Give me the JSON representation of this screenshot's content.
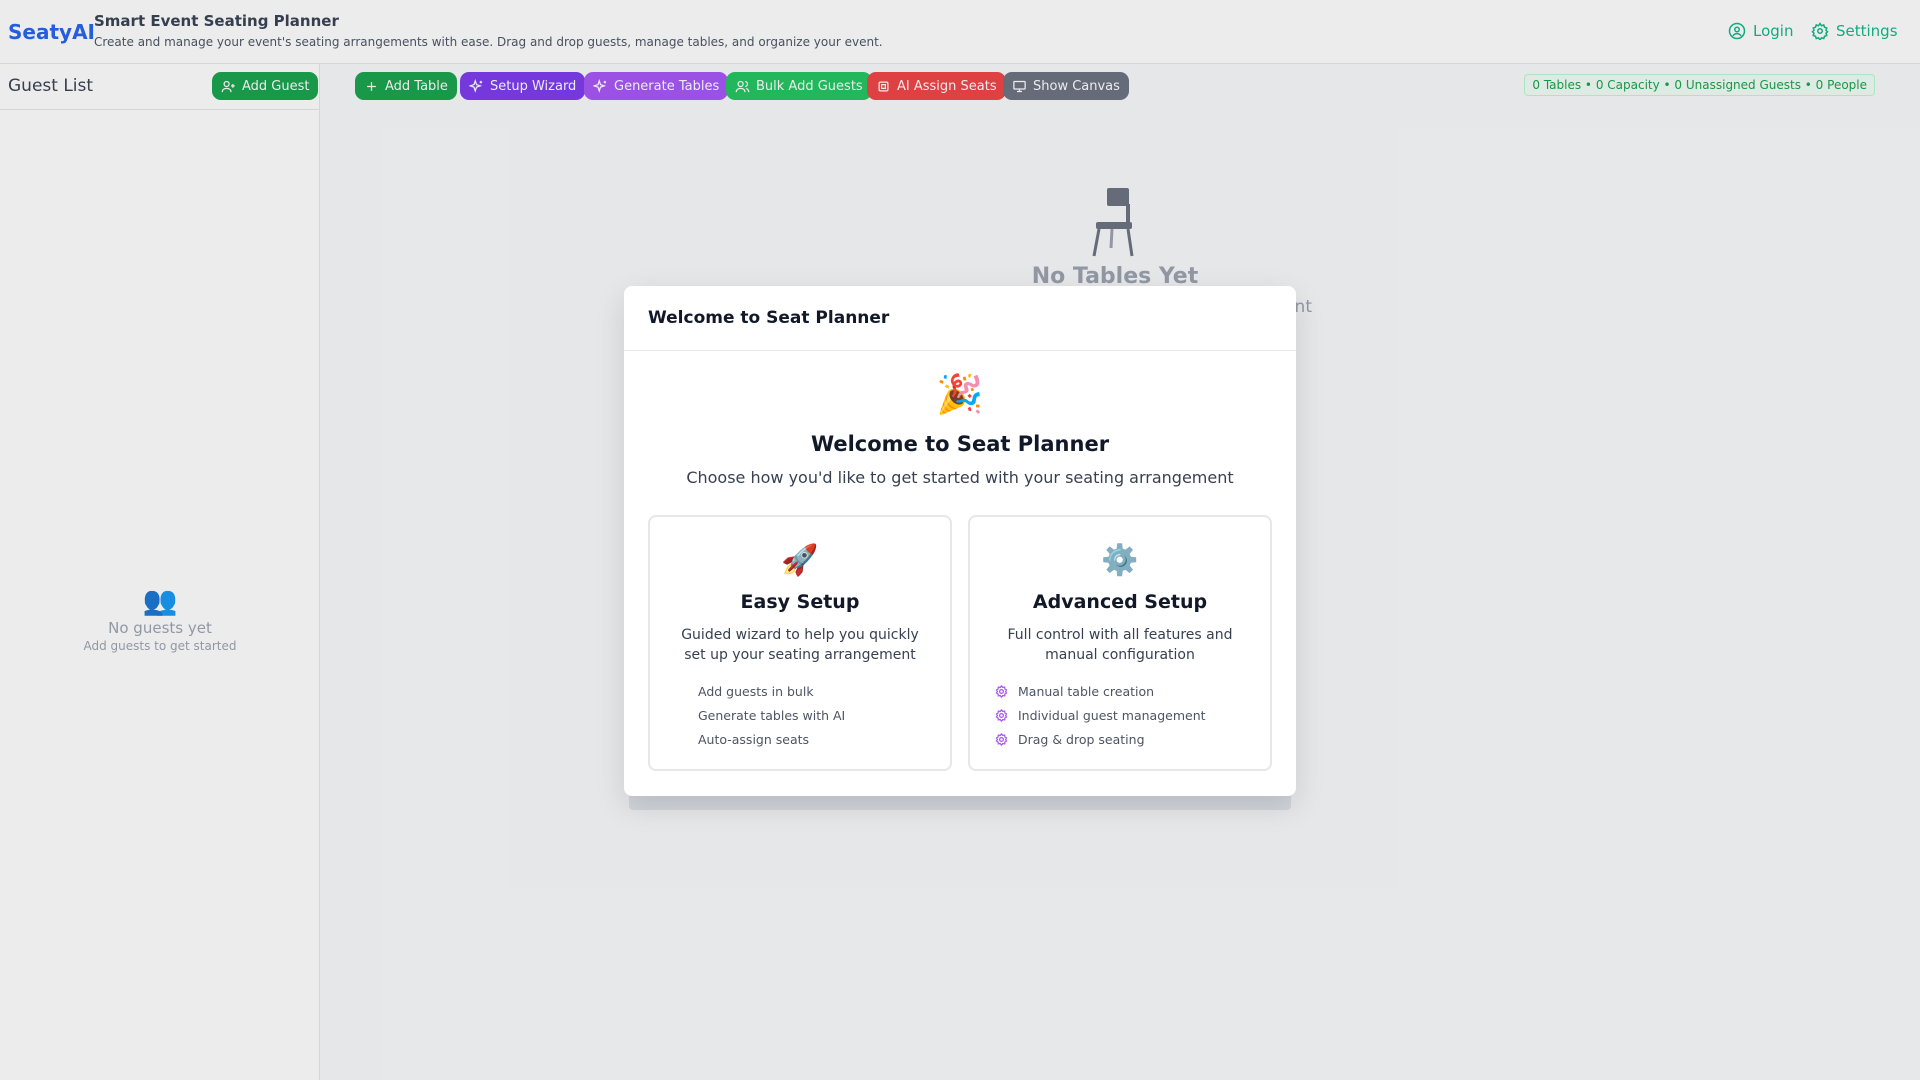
{
  "header": {
    "logo": "SeatyAI",
    "title": "Smart Event Seating Planner",
    "subtitle": "Create and manage your event's seating arrangements with ease. Drag and drop guests, manage tables, and organize your event.",
    "login": "Login",
    "settings": "Settings"
  },
  "sidebar": {
    "title": "Guest List",
    "add_guest": "Add Guest",
    "empty_title": "No guests yet",
    "empty_sub": "Add guests to get started"
  },
  "toolbar": {
    "add_table": "Add Table",
    "setup_wizard": "Setup Wizard",
    "generate_tables": "Generate Tables",
    "bulk_add_guests": "Bulk Add Guests",
    "ai_assign_seats": "AI Assign Seats",
    "show_canvas": "Show Canvas",
    "stats": "0 Tables • 0 Capacity • 0 Unassigned Guests • 0 People"
  },
  "canvas": {
    "empty_title": "No Tables Yet",
    "empty_desc_visible": "ngement"
  },
  "modal": {
    "header": "Welcome to Seat Planner",
    "emoji": "🎉",
    "title": "Welcome to Seat Planner",
    "subtitle": "Choose how you'd like to get started with your seating arrangement",
    "easy": {
      "icon": "🚀",
      "title": "Easy Setup",
      "desc": "Guided wizard to help you quickly set up your seating arrangement",
      "features": [
        "Add guests in bulk",
        "Generate tables with AI",
        "Auto-assign seats"
      ]
    },
    "advanced": {
      "icon": "⚙️",
      "title": "Advanced Setup",
      "desc": "Full control with all features and manual configuration",
      "features": [
        "Manual table creation",
        "Individual guest management",
        "Drag & drop seating"
      ]
    }
  },
  "colors": {
    "brand": "#2563eb",
    "green": "#10b981",
    "purple": "#8b5cf6",
    "violet": "#a855f7",
    "red": "#ef4444",
    "gray": "#6b7280"
  }
}
